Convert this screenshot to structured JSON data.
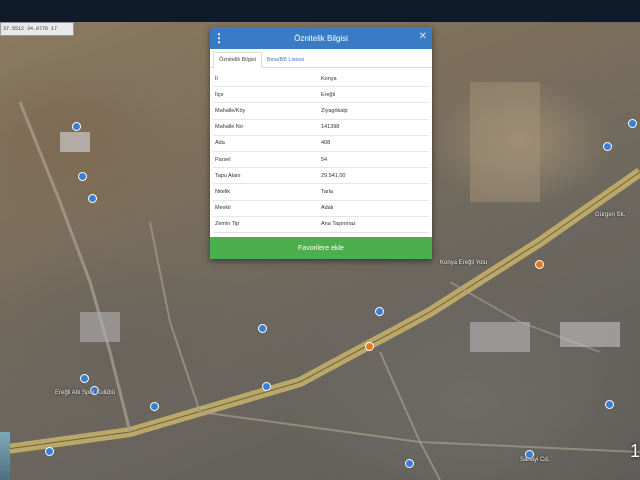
{
  "coords": {
    "lat": "37.5512",
    "lon": "34.0776",
    "zoom": "17"
  },
  "dialog": {
    "title": "Öznitelik Bilgisi",
    "tabs": [
      "Öznitelik Bilgisi",
      "Bina/BB Listesi"
    ],
    "rows": [
      {
        "key": "İl",
        "value": "Konya"
      },
      {
        "key": "İlçe",
        "value": "Ereğli"
      },
      {
        "key": "Mahalle/Köy",
        "value": "Ziyagökalp"
      },
      {
        "key": "Mahalle No",
        "value": "141398"
      },
      {
        "key": "Ada",
        "value": "408"
      },
      {
        "key": "Parsel",
        "value": "54"
      },
      {
        "key": "Tapu Alanı",
        "value": "29.941,00"
      },
      {
        "key": "Nitelik",
        "value": "Tarla"
      },
      {
        "key": "Mevkii",
        "value": "Adalı"
      },
      {
        "key": "Zemin Tip",
        "value": "Ana Taşınmaz"
      },
      {
        "key": "Pafta",
        "value": "82"
      }
    ],
    "favorite_button": "Favorilere ekle"
  },
  "map": {
    "labels": [
      "Ereğli Atlı Spor Kulübü",
      "Sanayi Cd.",
      "Konya Ereğli Yolu",
      "Gürgen Sk."
    ],
    "page_number": "1"
  }
}
